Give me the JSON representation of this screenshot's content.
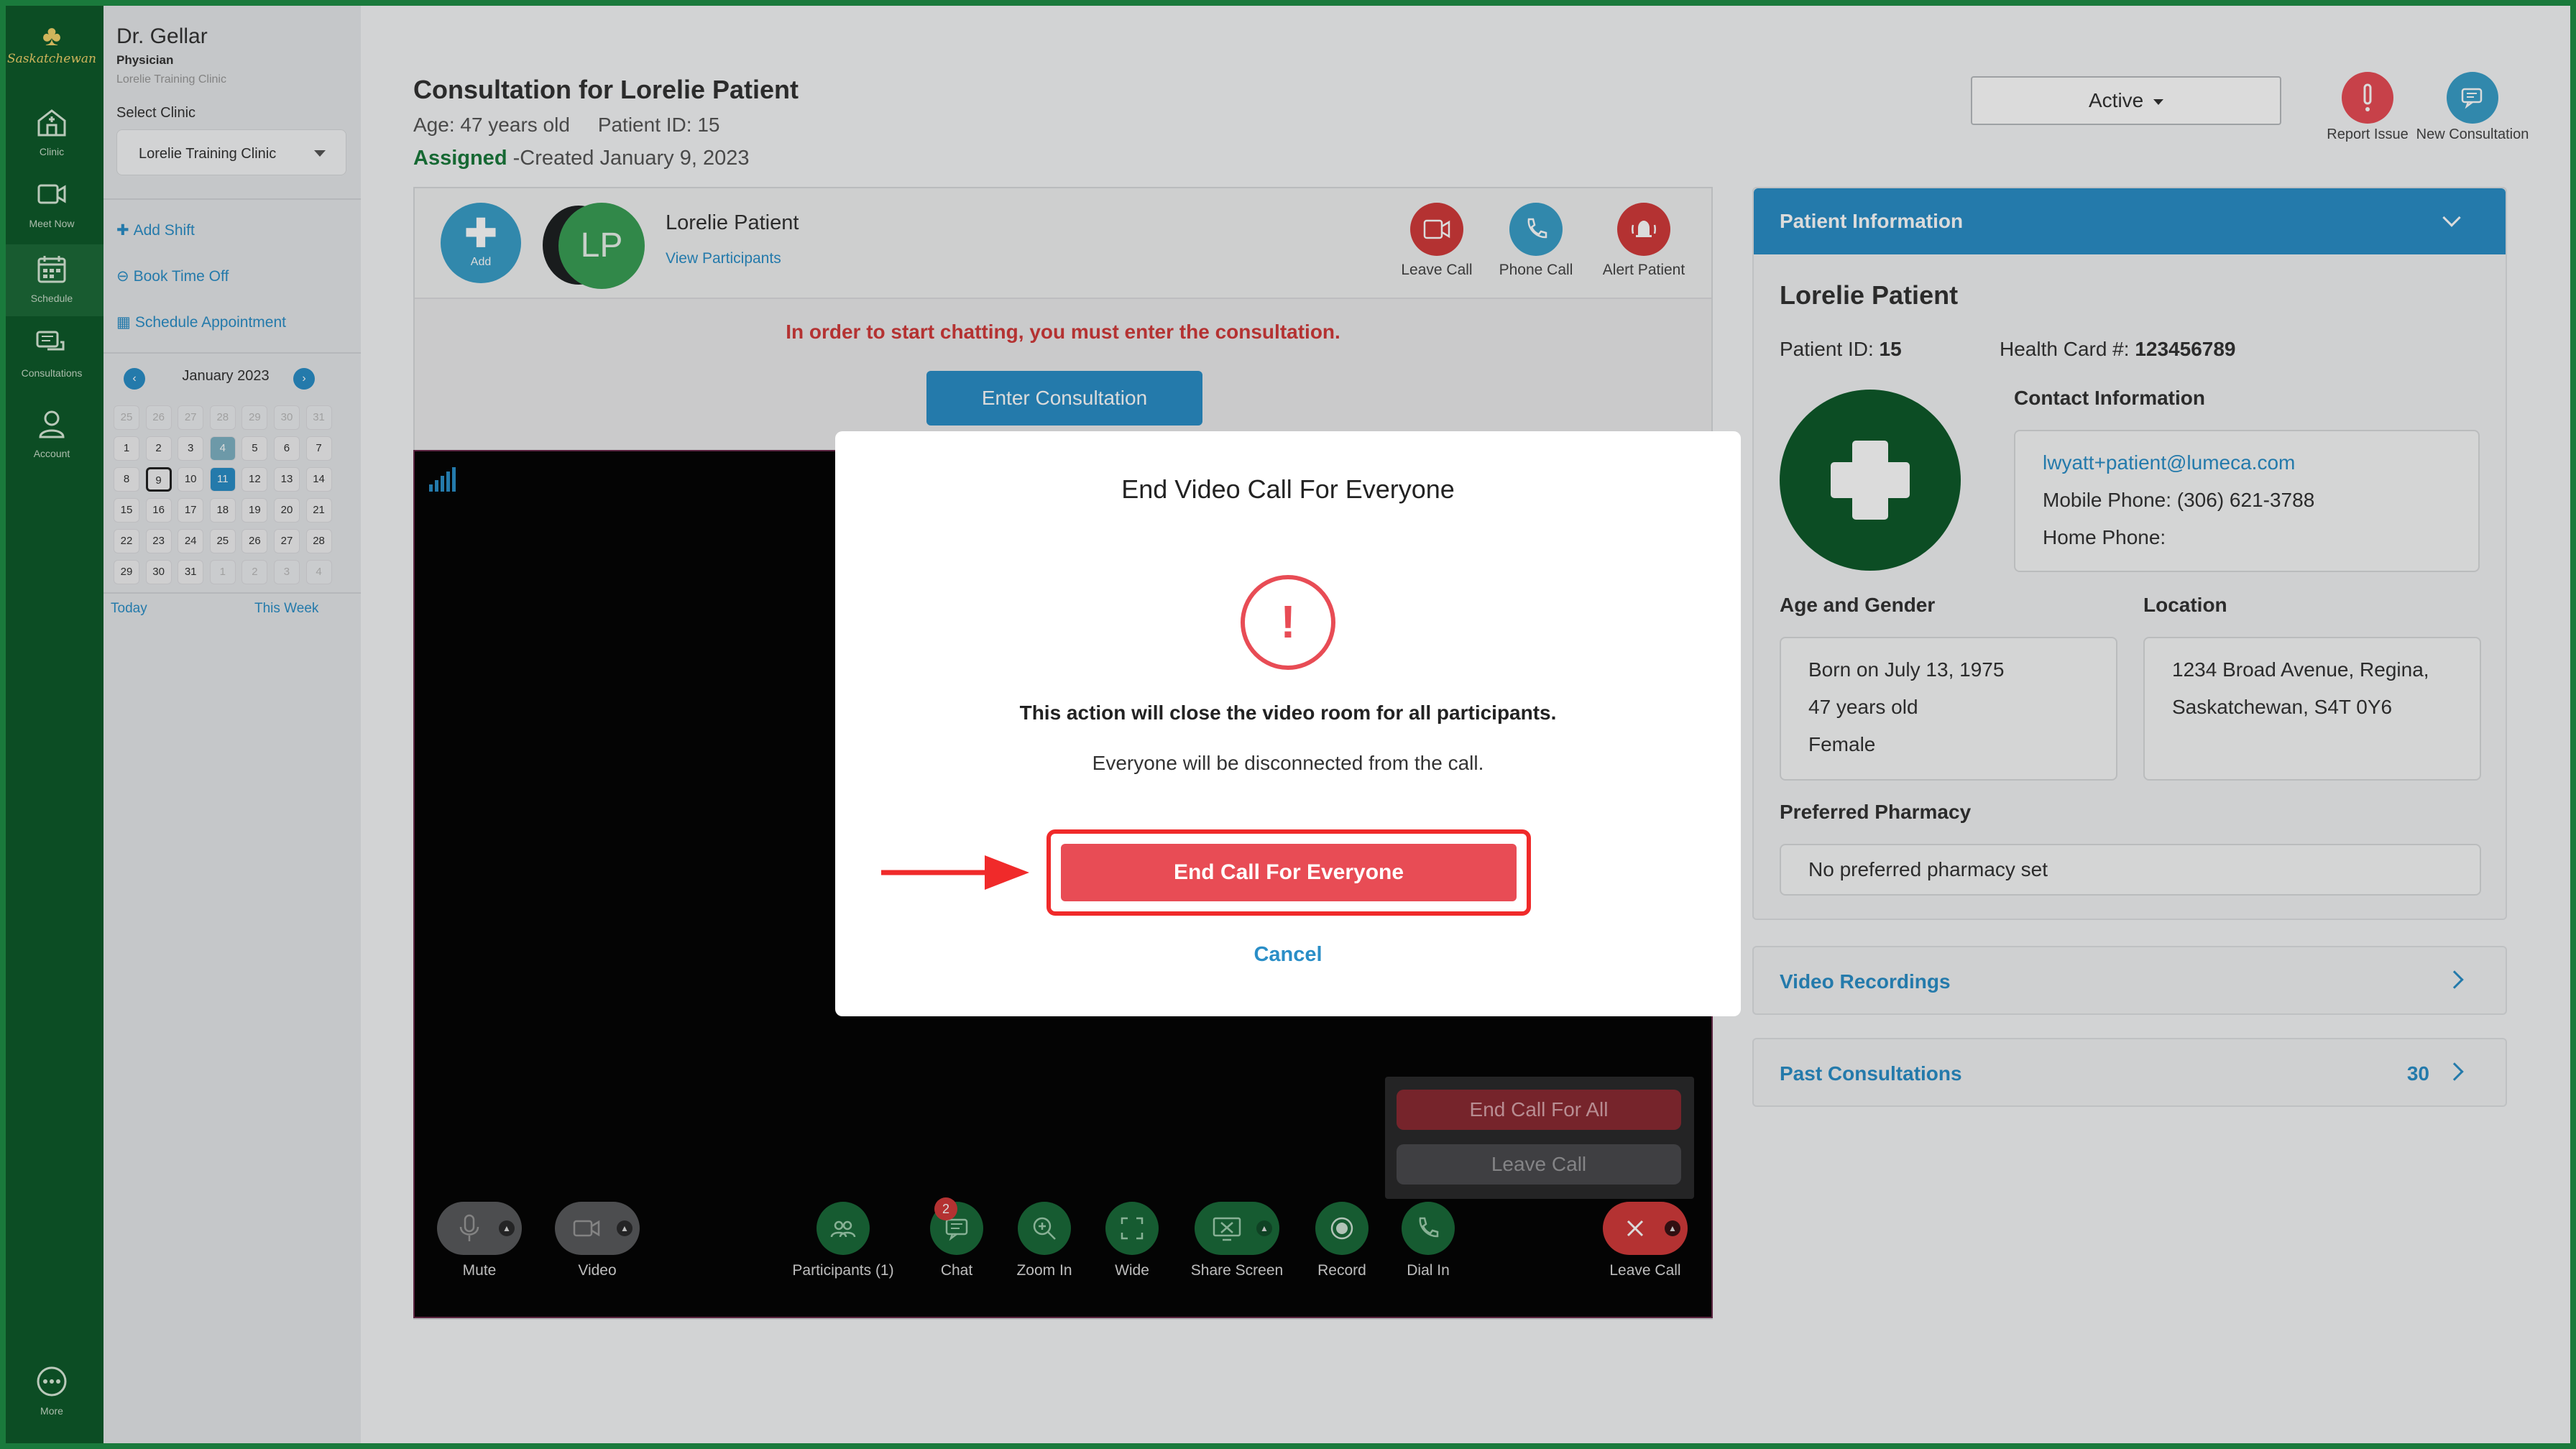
{
  "sidebar": {
    "logo_text": "Saskatchewan",
    "items": [
      {
        "label": "Clinic",
        "icon": "clinic-icon"
      },
      {
        "label": "Meet Now",
        "icon": "video-camera-icon"
      },
      {
        "label": "Schedule",
        "icon": "calendar-icon"
      },
      {
        "label": "Consultations",
        "icon": "chat-bubbles-icon"
      },
      {
        "label": "Account",
        "icon": "user-icon"
      },
      {
        "label": "More",
        "icon": "more-dots-icon"
      }
    ]
  },
  "left_panel": {
    "doctor_name": "Dr. Gellar",
    "role": "Physician",
    "clinic": "Lorelie Training Clinic",
    "select_clinic_label": "Select Clinic",
    "selected_clinic": "Lorelie Training Clinic",
    "links": [
      "Add Shift",
      "Book Time Off",
      "Schedule Appointment"
    ],
    "calendar": {
      "month": "January 2023",
      "days": [
        "25",
        "26",
        "27",
        "28",
        "29",
        "30",
        "31",
        "1",
        "2",
        "3",
        "4",
        "5",
        "6",
        "7",
        "8",
        "9",
        "10",
        "11",
        "12",
        "13",
        "14",
        "15",
        "16",
        "17",
        "18",
        "19",
        "20",
        "21",
        "22",
        "23",
        "24",
        "25",
        "26",
        "27",
        "28",
        "29",
        "30",
        "31",
        "1",
        "2",
        "3",
        "4"
      ],
      "today_label": "Today",
      "week_label": "This Week"
    }
  },
  "header": {
    "title": "Consultation for Lorelie Patient",
    "age_id": "Age: 47 years old     Patient ID: 15",
    "assigned": "Assigned",
    "created": " -Created January 9, 2023",
    "status": "Active",
    "report_issue": "Report Issue",
    "new_consultation": "New Consultation"
  },
  "consultation": {
    "add_label": "Add",
    "avatar_initials": "LP",
    "patient_name": "Lorelie Patient",
    "view_participants": "View Participants",
    "actions": [
      "Leave Call",
      "Phone Call",
      "Alert Patient"
    ],
    "chat_warning": "In order to start chatting, you must enter the consultation.",
    "enter_button": "Enter Consultation"
  },
  "video": {
    "end_call_all": "End Call For All",
    "leave_call_menu": "Leave Call",
    "toolbar": [
      "Mute",
      "Video",
      "Participants (1)",
      "Chat",
      "Zoom In",
      "Wide",
      "Share Screen",
      "Record",
      "Dial In",
      "Leave Call"
    ],
    "chat_badge": "2"
  },
  "patient_info": {
    "header": "Patient Information",
    "name": "Lorelie Patient",
    "patient_id_label": "Patient ID: ",
    "patient_id": "15",
    "health_card_label": "Health Card #: ",
    "health_card": "123456789",
    "contact_label": "Contact Information",
    "email": "lwyatt+patient@lumeca.com",
    "mobile": "Mobile Phone: (306) 621-3788",
    "home": "Home Phone:",
    "age_gender_label": "Age and Gender",
    "born": "Born on July 13, 1975",
    "age": "47 years old",
    "gender": "Female",
    "location_label": "Location",
    "location_line1": "1234 Broad Avenue, Regina,",
    "location_line2": "Saskatchewan, S4T 0Y6",
    "pharmacy_label": "Preferred Pharmacy",
    "pharmacy": "No preferred pharmacy set"
  },
  "accordions": {
    "video_recordings": "Video Recordings",
    "past_consultations": "Past Consultations",
    "past_count": "30"
  },
  "modal": {
    "title": "End Video Call For Everyone",
    "line1": "This action will close the video room for all participants.",
    "line2": "Everyone will be disconnected from the call.",
    "confirm": "End Call For Everyone",
    "cancel": "Cancel"
  },
  "colors": {
    "brand_green": "#0f5a2b",
    "accent_blue": "#2a8ec7",
    "danger_red": "#e84c55",
    "highlight_red": "#f02a2a"
  }
}
